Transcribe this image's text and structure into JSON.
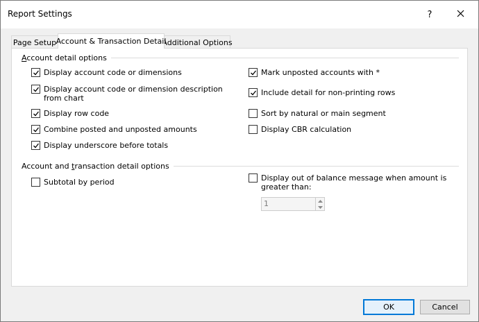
{
  "window": {
    "title": "Report Settings",
    "help_label": "?",
    "close_label": "✕"
  },
  "tabs": [
    {
      "label": "Page Setup",
      "active": false
    },
    {
      "label": "Account & Transaction Detail",
      "active": true
    },
    {
      "label": "Additional Options",
      "active": false
    }
  ],
  "account_detail": {
    "group_title_prefix": "A",
    "group_title_rest": "ccount detail options",
    "left": [
      {
        "label": "Display account code or dimensions",
        "checked": true
      },
      {
        "label": "Display account code or dimension description from chart",
        "checked": true
      },
      {
        "label": "Display row code",
        "checked": true
      },
      {
        "label": "Combine posted and unposted amounts",
        "checked": true
      },
      {
        "label": "Display underscore before totals",
        "checked": true
      }
    ],
    "right": [
      {
        "label": "Mark unposted accounts with *",
        "checked": true
      },
      {
        "label": "Include detail for non-printing rows",
        "checked": true
      },
      {
        "label": "Sort by natural or main segment",
        "checked": false
      },
      {
        "label": "Display CBR calculation",
        "checked": false
      }
    ]
  },
  "transaction_detail": {
    "group_title_before": "Account and ",
    "group_title_underlined": "t",
    "group_title_after": "ransaction detail options",
    "subtotal_label": "Subtotal by period",
    "subtotal_checked": false,
    "out_of_balance_label": "Display out of balance message when amount is greater than:",
    "out_of_balance_checked": false,
    "threshold_value": "1"
  },
  "buttons": {
    "ok": "OK",
    "cancel": "Cancel"
  }
}
